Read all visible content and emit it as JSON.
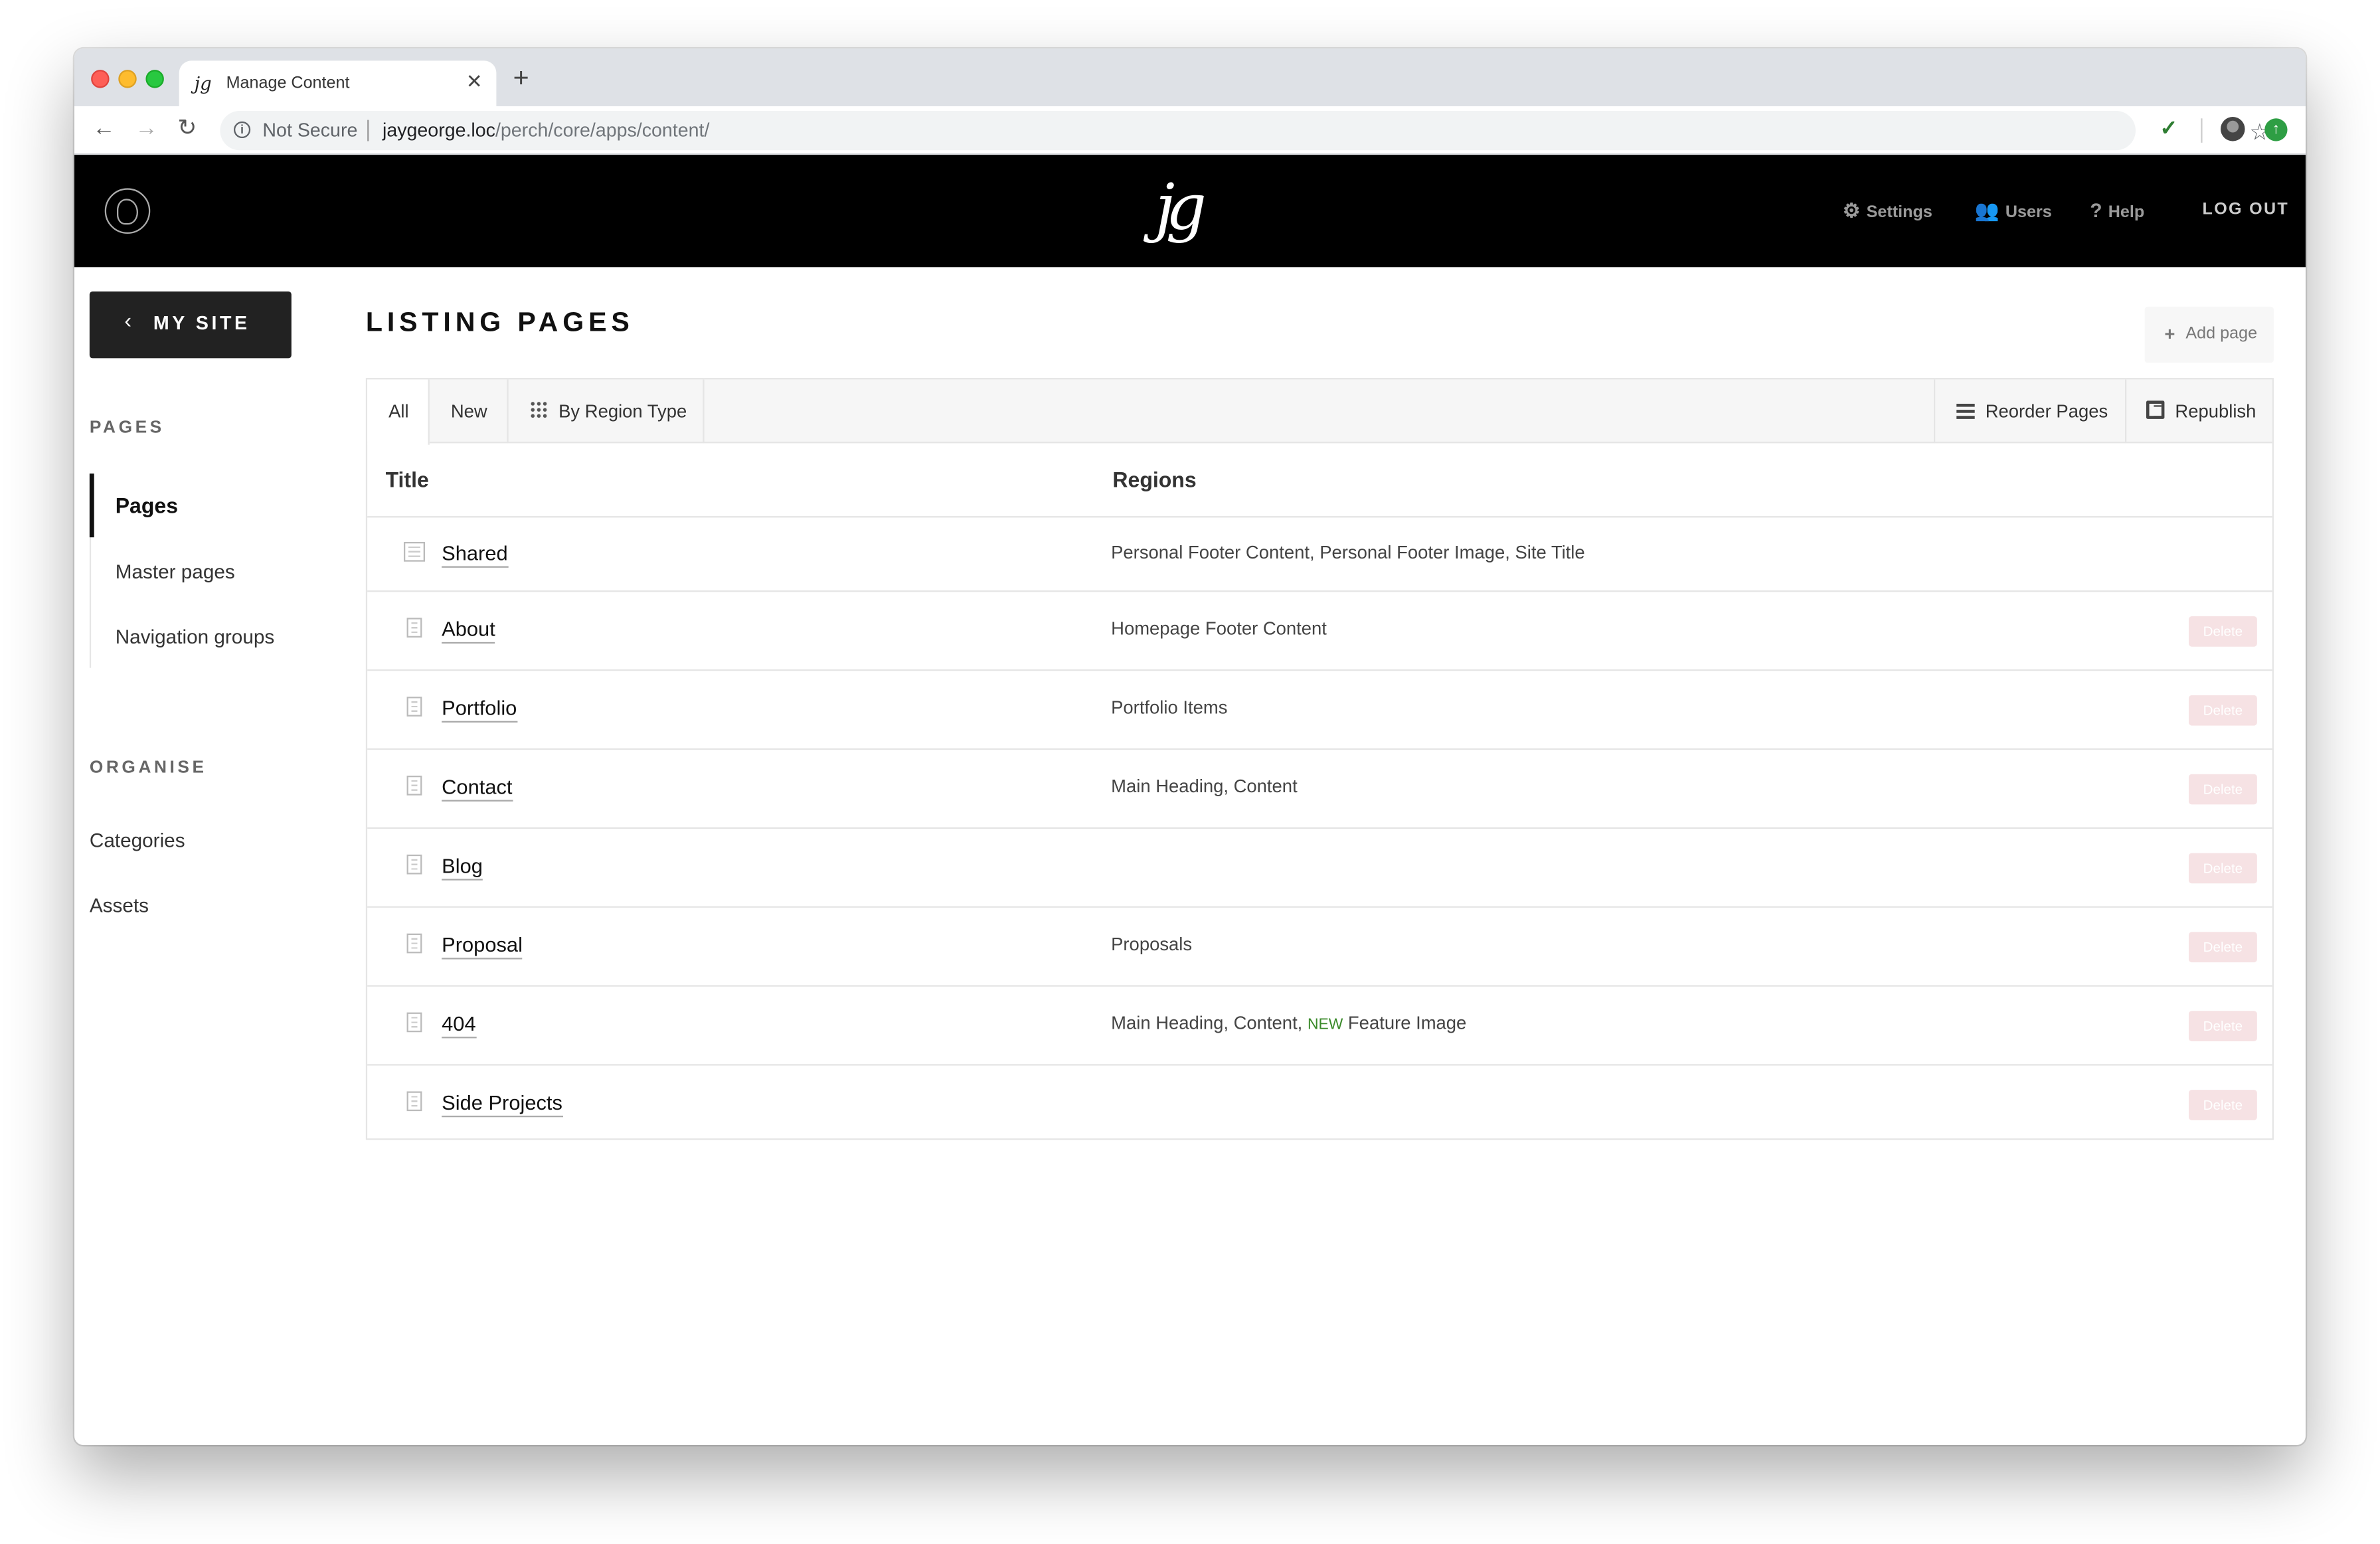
{
  "browser": {
    "tab_title": "Manage Content",
    "tab_favicon": "jg",
    "security_text": "Not Secure",
    "url_host": "jaygeorge.loc",
    "url_path": "/perch/core/apps/content/",
    "icons": [
      "back-icon",
      "forward-icon",
      "reload-icon",
      "info-icon",
      "star-icon",
      "extension-icon",
      "profile-icon",
      "update-icon"
    ]
  },
  "header": {
    "logo_text": "jg",
    "settings_label": "Settings",
    "users_label": "Users",
    "help_label": "Help",
    "logout_label": "LOG OUT"
  },
  "sidebar": {
    "my_site_label": "MY SITE",
    "pages_heading": "PAGES",
    "pages_items": [
      "Pages",
      "Master pages",
      "Navigation groups"
    ],
    "organise_heading": "ORGANISE",
    "organise_items": [
      "Categories",
      "Assets"
    ]
  },
  "main": {
    "title": "LISTING PAGES",
    "add_page_label": "Add page",
    "filters": [
      "All",
      "New",
      "By Region Type"
    ],
    "reorder_label": "Reorder Pages",
    "republish_label": "Republish",
    "columns": [
      "Title",
      "Regions"
    ],
    "delete_label": "Delete",
    "new_badge": "NEW",
    "rows": [
      {
        "title": "Shared",
        "regions": "Personal Footer Content, Personal Footer Image, Site Title"
      },
      {
        "title": "About",
        "regions": "Homepage Footer Content"
      },
      {
        "title": "Portfolio",
        "regions": "Portfolio Items"
      },
      {
        "title": "Contact",
        "regions": "Main Heading, Content"
      },
      {
        "title": "Blog",
        "regions": ""
      },
      {
        "title": "Proposal",
        "regions": "Proposals"
      },
      {
        "title": "404",
        "regions": "Main Heading, Content, ",
        "regions_after_badge": " Feature Image"
      },
      {
        "title": "Side Projects",
        "regions": ""
      }
    ]
  },
  "colors": {
    "header_bg": "#000000",
    "my_site_bg": "#222222",
    "delete_bg": "#f6e2e4",
    "new_badge": "#3a8a2a"
  }
}
